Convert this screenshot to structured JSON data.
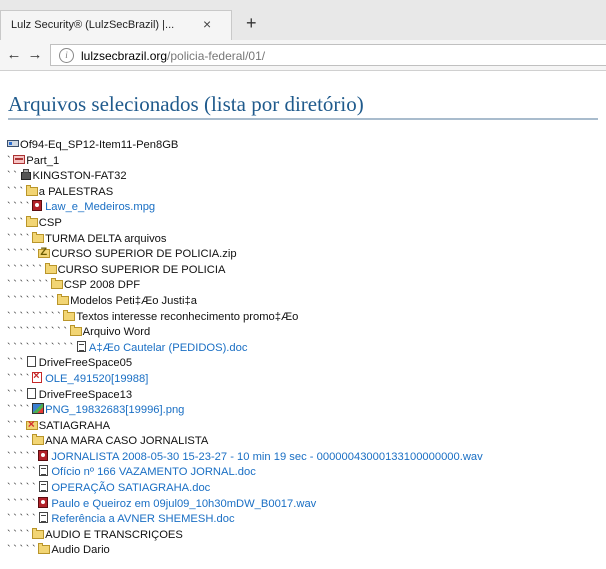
{
  "browser": {
    "tab_title": "Lulz Security® (LulzSecBrazil) |...",
    "tab_close": "×",
    "new_tab": "+",
    "back": "←",
    "forward": "→",
    "info": "i",
    "url_host": "lulzsecbrazil.org",
    "url_path": "/policia-federal/01/"
  },
  "page": {
    "title": "Arquivos selecionados (lista por diretório)"
  },
  "tree": [
    {
      "depth": 0,
      "icon": "drive",
      "label": "Of94-Eq_SP12-Item11-Pen8GB",
      "link": false
    },
    {
      "depth": 1,
      "icon": "part",
      "label": "Part_1",
      "link": false
    },
    {
      "depth": 2,
      "icon": "usb",
      "label": "KINGSTON-FAT32",
      "link": false
    },
    {
      "depth": 3,
      "icon": "folder",
      "label": "a PALESTRAS",
      "link": false
    },
    {
      "depth": 4,
      "icon": "media",
      "label": "Law_e_Medeiros.mpg",
      "link": true
    },
    {
      "depth": 3,
      "icon": "folder",
      "label": "CSP",
      "link": false
    },
    {
      "depth": 4,
      "icon": "folder",
      "label": "TURMA DELTA arquivos",
      "link": false
    },
    {
      "depth": 5,
      "icon": "zip",
      "label": "CURSO SUPERIOR DE POLICIA.zip",
      "link": false
    },
    {
      "depth": 6,
      "icon": "folder",
      "label": "CURSO SUPERIOR DE POLICIA",
      "link": false
    },
    {
      "depth": 7,
      "icon": "folder",
      "label": "CSP 2008 DPF",
      "link": false
    },
    {
      "depth": 8,
      "icon": "folder",
      "label": "Modelos Peti‡Æo Justi‡a",
      "link": false
    },
    {
      "depth": 9,
      "icon": "folder",
      "label": "Textos interesse reconhecimento promo‡Æo",
      "link": false
    },
    {
      "depth": 10,
      "icon": "folder",
      "label": "Arquivo Word",
      "link": false
    },
    {
      "depth": 11,
      "icon": "doc",
      "label": "A‡Æo Cautelar (PEDIDOS).doc",
      "link": true
    },
    {
      "depth": 3,
      "icon": "blank",
      "label": "DriveFreeSpace05",
      "link": false
    },
    {
      "depth": 4,
      "icon": "ole",
      "label": "OLE_491520[19988]",
      "link": true
    },
    {
      "depth": 3,
      "icon": "blank",
      "label": "DriveFreeSpace13",
      "link": false
    },
    {
      "depth": 4,
      "icon": "image",
      "label": "PNG_19832683[19996].png",
      "link": true
    },
    {
      "depth": 3,
      "icon": "redfolder",
      "label": "SATIAGRAHA",
      "link": false
    },
    {
      "depth": 4,
      "icon": "folder",
      "label": "ANA MARA CASO JORNALISTA",
      "link": false
    },
    {
      "depth": 5,
      "icon": "media",
      "label": "JORNALISTA 2008-05-30 15-23-27 - 10 min 19 sec - 00000043000133100000000.wav",
      "link": true
    },
    {
      "depth": 5,
      "icon": "doc",
      "label": "Ofício nº 166 VAZAMENTO JORNAL.doc",
      "link": true
    },
    {
      "depth": 5,
      "icon": "doc",
      "label": "OPERAÇÃO SATIAGRAHA.doc",
      "link": true
    },
    {
      "depth": 5,
      "icon": "media",
      "label": "Paulo e Queiroz em 09jul09_10h30mDW_B0017.wav",
      "link": true
    },
    {
      "depth": 5,
      "icon": "doc",
      "label": "Referência a AVNER SHEMESH.doc",
      "link": true
    },
    {
      "depth": 4,
      "icon": "folder",
      "label": "AUDIO E TRANSCRIÇOES",
      "link": false
    },
    {
      "depth": 5,
      "icon": "folder",
      "label": "Audio Dario",
      "link": false
    }
  ]
}
